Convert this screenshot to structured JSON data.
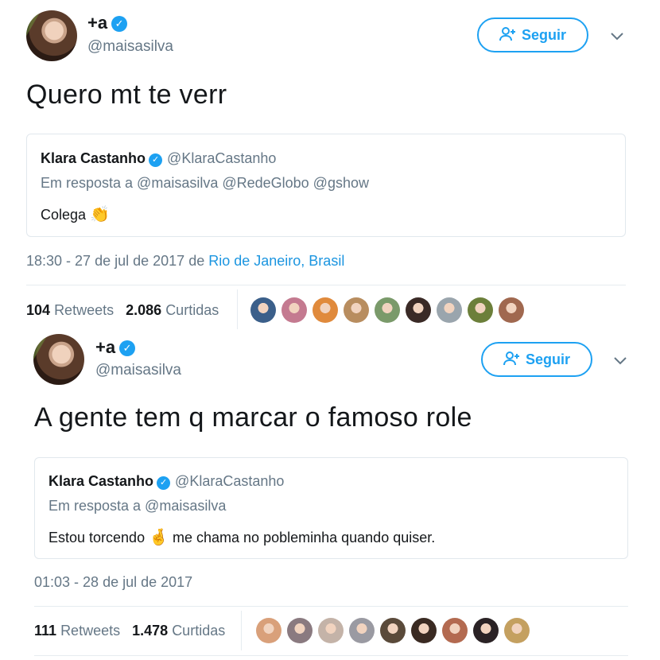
{
  "tweets": [
    {
      "name": "+a",
      "handle": "@maisasilva",
      "follow_label": "Seguir",
      "text": "Quero mt te verr",
      "quote": {
        "name": "Klara Castanho",
        "handle": "@KlaraCastanho",
        "reply": "Em resposta a @maisasilva @RedeGlobo @gshow",
        "text": "Colega",
        "emoji": "👏"
      },
      "time": "18:30 - 27 de jul de 2017",
      "location_prefix": "de",
      "location": "Rio de Janeiro, Brasil",
      "retweets_count": "104",
      "retweets_label": "Retweets",
      "likes_count": "2.086",
      "likes_label": "Curtidas"
    },
    {
      "name": "+a",
      "handle": "@maisasilva",
      "follow_label": "Seguir",
      "text": "A gente tem q marcar o famoso role",
      "quote": {
        "name": "Klara Castanho",
        "handle": "@KlaraCastanho",
        "reply": "Em resposta a @maisasilva",
        "text_before": "Estou torcendo",
        "emoji": "🤞",
        "text_after": "me chama no pobleminha quando quiser."
      },
      "time": "01:03 - 28 de jul de 2017",
      "retweets_count": "111",
      "retweets_label": "Retweets",
      "likes_count": "1.478",
      "likes_label": "Curtidas"
    }
  ],
  "icons": {
    "verified": "verified-badge-icon",
    "follow": "add-user-icon",
    "caret": "chevron-down-icon"
  },
  "colors": {
    "accent": "#1da1f2",
    "link": "#1b95e0",
    "muted": "#657786"
  },
  "likers_1": [
    "#3b5f8a",
    "#c47a90",
    "#e08a3c",
    "#b88d5f",
    "#7a9a6a",
    "#3a2a26",
    "#9aa5ad",
    "#6c7f3a",
    "#a0684f"
  ],
  "likers_2": [
    "#d9a07a",
    "#8a7a80",
    "#c4b3a8",
    "#9a9aa2",
    "#5a4a3a",
    "#3a2a22",
    "#b36a50",
    "#2a2225",
    "#c4a060"
  ]
}
